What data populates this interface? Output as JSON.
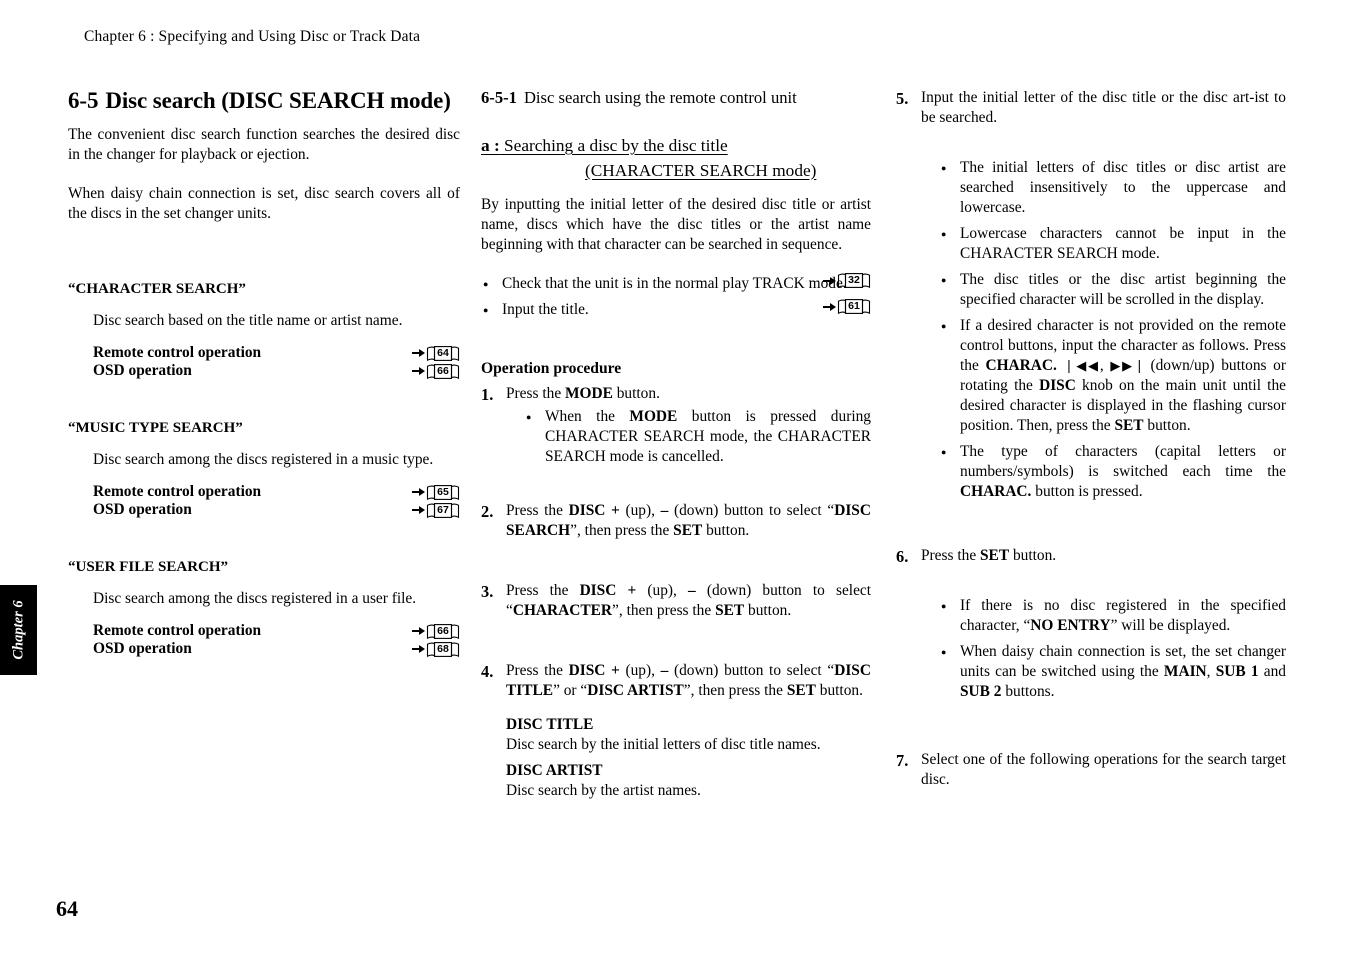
{
  "running_head": "Chapter 6 : Specifying and Using Disc or Track Data",
  "chapter_tab": "Chapter 6",
  "folio": "64",
  "left_column": {
    "section_number": "6-5",
    "section_title": "Disc search (DISC SEARCH mode)",
    "intro_paragraphs": [
      "The convenient disc search function searches the desired disc in the changer for playback or ejection.",
      "When daisy chain connection is set, disc search covers all of the discs in the set changer units."
    ],
    "search_modes": [
      {
        "name": "“CHARACTER SEARCH”",
        "description": "Disc search based on the title name or artist name.",
        "refs": [
          {
            "label": "Remote control operation",
            "page": "64"
          },
          {
            "label": "OSD operation",
            "page": "66"
          }
        ]
      },
      {
        "name": "“MUSIC TYPE SEARCH”",
        "description": "Disc search among the discs registered in a music type.",
        "refs": [
          {
            "label": "Remote control operation",
            "page": "65"
          },
          {
            "label": "OSD operation",
            "page": "67"
          }
        ]
      },
      {
        "name": "“USER FILE SEARCH”",
        "description": "Disc search among the discs registered in a user file.",
        "refs": [
          {
            "label": "Remote control operation",
            "page": "66"
          },
          {
            "label": "OSD operation",
            "page": "68"
          }
        ]
      }
    ]
  },
  "middle_column": {
    "subsection_number": "6-5-1",
    "subsection_title": "Disc search using the remote control unit",
    "heading_a": {
      "marker": "a :",
      "line1": "Searching a disc by the disc title",
      "line2": "(CHARACTER SEARCH  mode)"
    },
    "intro": "By inputting the initial letter of the desired disc title or artist name, discs which have the disc titles or the artist name beginning with that character can be searched in sequence.",
    "intro_bullets": [
      {
        "text": "Check that the unit is in the normal play TRACK mode.",
        "page": "32"
      },
      {
        "text": "Input the title.",
        "page": "61"
      }
    ],
    "operation_procedure_heading": "Operation procedure",
    "steps": [
      {
        "num": "1.",
        "text_html": "Press the <b>MODE</b> button.",
        "bullets_html": [
          "When the <b>MODE</b> button is pressed during CHARACTER SEARCH mode, the CHARACTER SEARCH mode is cancelled."
        ]
      },
      {
        "num": "2.",
        "text_html": "Press the <b>DISC +</b> (up), <b>–</b> (down) button to select “<b>DISC SEARCH</b>”, then press the <b>SET</b> button."
      },
      {
        "num": "3.",
        "text_html": "Press the <b>DISC +</b> (up), <b>–</b> (down) button to select “<b>CHARACTER</b>”, then press the <b>SET</b> button."
      },
      {
        "num": "4.",
        "text_html": "Press the <b>DISC +</b> (up), <b>–</b> (down) button to select “<b>DISC TITLE</b>” or “<b>DISC ARTIST</b>”, then press the <b>SET</b> button."
      }
    ],
    "definitions": [
      {
        "title": "DISC TITLE",
        "body": "Disc search by the initial letters of disc title names."
      },
      {
        "title": "DISC ARTIST",
        "body": "Disc search by the artist names."
      }
    ]
  },
  "right_column": {
    "steps": [
      {
        "num": "5.",
        "text_html": "Input the initial letter of the disc title or the disc art-ist to be searched.",
        "bullets_html": [
          "The initial letters of disc titles or disc artist are searched insensitively to the uppercase and lowercase.",
          "Lowercase characters cannot be input in the CHARACTER SEARCH mode.",
          "The disc titles or the disc artist beginning the specified character will be scrolled in the display.",
          "If a desired character is not provided on the remote control buttons, input the character as follows. Press the <b>CHARAC.</b> <span class=\"trk\">❘◀◀</span>, <span class=\"trk\">▶▶❘</span> (down/up) buttons or rotating the <b>DISC</b> knob on the main unit until the desired character is displayed in the flashing cursor position. Then, press the <b>SET</b> button.",
          "The type of characters (capital letters or numbers/symbols) is switched each time the <b>CHARAC.</b> button is pressed."
        ]
      },
      {
        "num": "6.",
        "text_html": "Press the <b>SET</b> button.",
        "bullets_html": [
          "If there is no disc registered in the specified character, “<b>NO ENTRY</b>” will be displayed.",
          "When daisy chain connection is set, the set changer units can be switched using the <b>MAIN</b>, <b>SUB 1</b> and <b>SUB 2</b> buttons."
        ]
      },
      {
        "num": "7.",
        "text_html": "Select one of the following operations for the search target disc."
      }
    ]
  }
}
